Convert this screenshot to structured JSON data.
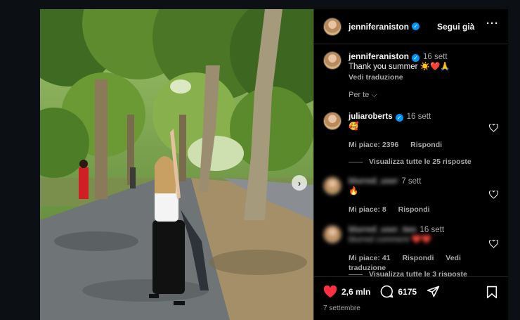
{
  "post": {
    "author": "jenniferaniston",
    "follow_label": "Segui già",
    "more_label": "···",
    "caption": {
      "author": "jenniferaniston",
      "time": "16 sett",
      "text": "Thank you summer ☀️❤️🙏",
      "translate_label": "Vedi traduzione"
    },
    "ranking_label": "Per te ⌵",
    "comments": [
      {
        "author": "juliaroberts",
        "verified": true,
        "time": "16 sett",
        "text": "🥰",
        "likes": "Mi piace: 2396",
        "reply_label": "Rispondi",
        "view_replies": "Visualizza tutte le 25 risposte"
      },
      {
        "author": "blurred_user",
        "time": "7 sett",
        "text": "🔥",
        "likes": "Mi piace: 8",
        "reply_label": "Rispondi"
      },
      {
        "author": "blurred_user_two",
        "time": "16 sett",
        "text": "blurred comment ❤️❤️",
        "likes": "Mi piace: 41",
        "reply_label": "Rispondi",
        "translate_label": "Vedi traduzione",
        "view_replies": "Visualizza tutte le 3 risposte"
      }
    ],
    "like_count": "2,6 mln",
    "comment_count": "6175",
    "date": "7 settembre"
  },
  "colors": {
    "accent_blue": "#0095f6",
    "like_red": "#ff3040",
    "secondary_text": "#a8a8a8"
  }
}
